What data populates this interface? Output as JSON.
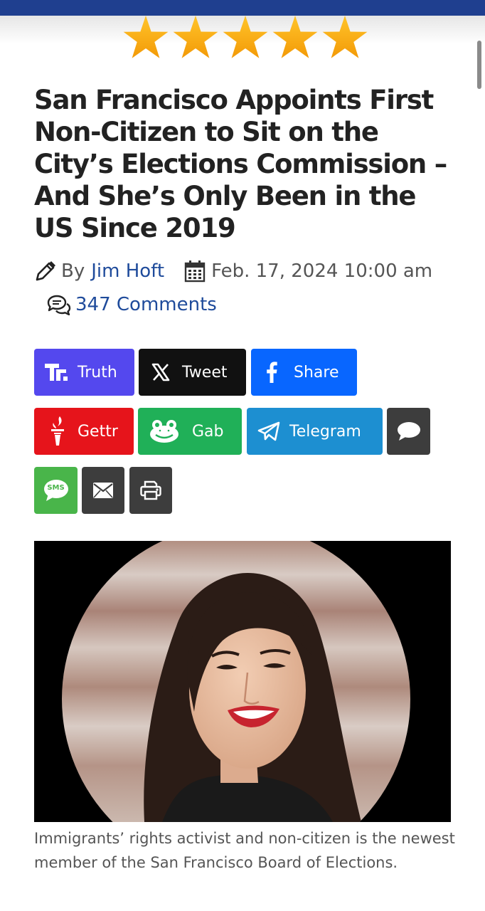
{
  "header": {
    "accent": "#1f3f8f"
  },
  "rating": {
    "stars": 5,
    "max": 5,
    "star_color": "#f7a310"
  },
  "article": {
    "title": "San Francisco Appoints First Non-Citizen to Sit on the City’s Elections Commission – And She’s Only Been in the US Since 2019",
    "by_label": "By",
    "author": "Jim Hoft",
    "date": "Feb. 17, 2024 10:00 am",
    "comments": "347 Comments",
    "caption": "Immigrants’ rights activist and non-citizen is the newest member of the San Francisco Board of Elections."
  },
  "share": {
    "truth": {
      "label": "Truth",
      "color": "#5448ee"
    },
    "tweet": {
      "label": "Tweet",
      "color": "#111111"
    },
    "facebook": {
      "label": "Share",
      "color": "#0866ff"
    },
    "gettr": {
      "label": "Gettr",
      "color": "#e6141b"
    },
    "gab": {
      "label": "Gab",
      "color": "#20b058"
    },
    "telegram": {
      "label": "Telegram",
      "color": "#1d8fd1"
    },
    "comment_color": "#3d3d3d",
    "sms": {
      "label": "SMS",
      "color": "#49b54a"
    },
    "email_color": "#3d3d3d",
    "print_color": "#3d3d3d"
  },
  "icons": {
    "author": "pencil-icon",
    "date": "calendar-icon",
    "comments": "comments-icon",
    "truth": "truth-social-icon",
    "tweet": "x-logo-icon",
    "facebook": "facebook-icon",
    "gettr": "gettr-torch-icon",
    "gab": "gab-frog-icon",
    "telegram": "paper-plane-icon",
    "comment": "speech-bubble-icon",
    "sms": "sms-icon",
    "email": "envelope-icon",
    "print": "printer-icon"
  }
}
